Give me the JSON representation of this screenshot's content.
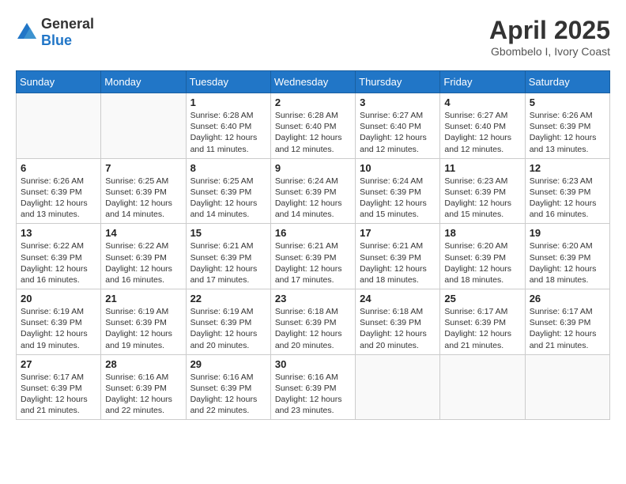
{
  "header": {
    "logo_general": "General",
    "logo_blue": "Blue",
    "month_year": "April 2025",
    "location": "Gbombelo I, Ivory Coast"
  },
  "days_of_week": [
    "Sunday",
    "Monday",
    "Tuesday",
    "Wednesday",
    "Thursday",
    "Friday",
    "Saturday"
  ],
  "weeks": [
    [
      {
        "day": "",
        "info": ""
      },
      {
        "day": "",
        "info": ""
      },
      {
        "day": "1",
        "info": "Sunrise: 6:28 AM\nSunset: 6:40 PM\nDaylight: 12 hours and 11 minutes."
      },
      {
        "day": "2",
        "info": "Sunrise: 6:28 AM\nSunset: 6:40 PM\nDaylight: 12 hours and 12 minutes."
      },
      {
        "day": "3",
        "info": "Sunrise: 6:27 AM\nSunset: 6:40 PM\nDaylight: 12 hours and 12 minutes."
      },
      {
        "day": "4",
        "info": "Sunrise: 6:27 AM\nSunset: 6:40 PM\nDaylight: 12 hours and 12 minutes."
      },
      {
        "day": "5",
        "info": "Sunrise: 6:26 AM\nSunset: 6:39 PM\nDaylight: 12 hours and 13 minutes."
      }
    ],
    [
      {
        "day": "6",
        "info": "Sunrise: 6:26 AM\nSunset: 6:39 PM\nDaylight: 12 hours and 13 minutes."
      },
      {
        "day": "7",
        "info": "Sunrise: 6:25 AM\nSunset: 6:39 PM\nDaylight: 12 hours and 14 minutes."
      },
      {
        "day": "8",
        "info": "Sunrise: 6:25 AM\nSunset: 6:39 PM\nDaylight: 12 hours and 14 minutes."
      },
      {
        "day": "9",
        "info": "Sunrise: 6:24 AM\nSunset: 6:39 PM\nDaylight: 12 hours and 14 minutes."
      },
      {
        "day": "10",
        "info": "Sunrise: 6:24 AM\nSunset: 6:39 PM\nDaylight: 12 hours and 15 minutes."
      },
      {
        "day": "11",
        "info": "Sunrise: 6:23 AM\nSunset: 6:39 PM\nDaylight: 12 hours and 15 minutes."
      },
      {
        "day": "12",
        "info": "Sunrise: 6:23 AM\nSunset: 6:39 PM\nDaylight: 12 hours and 16 minutes."
      }
    ],
    [
      {
        "day": "13",
        "info": "Sunrise: 6:22 AM\nSunset: 6:39 PM\nDaylight: 12 hours and 16 minutes."
      },
      {
        "day": "14",
        "info": "Sunrise: 6:22 AM\nSunset: 6:39 PM\nDaylight: 12 hours and 16 minutes."
      },
      {
        "day": "15",
        "info": "Sunrise: 6:21 AM\nSunset: 6:39 PM\nDaylight: 12 hours and 17 minutes."
      },
      {
        "day": "16",
        "info": "Sunrise: 6:21 AM\nSunset: 6:39 PM\nDaylight: 12 hours and 17 minutes."
      },
      {
        "day": "17",
        "info": "Sunrise: 6:21 AM\nSunset: 6:39 PM\nDaylight: 12 hours and 18 minutes."
      },
      {
        "day": "18",
        "info": "Sunrise: 6:20 AM\nSunset: 6:39 PM\nDaylight: 12 hours and 18 minutes."
      },
      {
        "day": "19",
        "info": "Sunrise: 6:20 AM\nSunset: 6:39 PM\nDaylight: 12 hours and 18 minutes."
      }
    ],
    [
      {
        "day": "20",
        "info": "Sunrise: 6:19 AM\nSunset: 6:39 PM\nDaylight: 12 hours and 19 minutes."
      },
      {
        "day": "21",
        "info": "Sunrise: 6:19 AM\nSunset: 6:39 PM\nDaylight: 12 hours and 19 minutes."
      },
      {
        "day": "22",
        "info": "Sunrise: 6:19 AM\nSunset: 6:39 PM\nDaylight: 12 hours and 20 minutes."
      },
      {
        "day": "23",
        "info": "Sunrise: 6:18 AM\nSunset: 6:39 PM\nDaylight: 12 hours and 20 minutes."
      },
      {
        "day": "24",
        "info": "Sunrise: 6:18 AM\nSunset: 6:39 PM\nDaylight: 12 hours and 20 minutes."
      },
      {
        "day": "25",
        "info": "Sunrise: 6:17 AM\nSunset: 6:39 PM\nDaylight: 12 hours and 21 minutes."
      },
      {
        "day": "26",
        "info": "Sunrise: 6:17 AM\nSunset: 6:39 PM\nDaylight: 12 hours and 21 minutes."
      }
    ],
    [
      {
        "day": "27",
        "info": "Sunrise: 6:17 AM\nSunset: 6:39 PM\nDaylight: 12 hours and 21 minutes."
      },
      {
        "day": "28",
        "info": "Sunrise: 6:16 AM\nSunset: 6:39 PM\nDaylight: 12 hours and 22 minutes."
      },
      {
        "day": "29",
        "info": "Sunrise: 6:16 AM\nSunset: 6:39 PM\nDaylight: 12 hours and 22 minutes."
      },
      {
        "day": "30",
        "info": "Sunrise: 6:16 AM\nSunset: 6:39 PM\nDaylight: 12 hours and 23 minutes."
      },
      {
        "day": "",
        "info": ""
      },
      {
        "day": "",
        "info": ""
      },
      {
        "day": "",
        "info": ""
      }
    ]
  ]
}
